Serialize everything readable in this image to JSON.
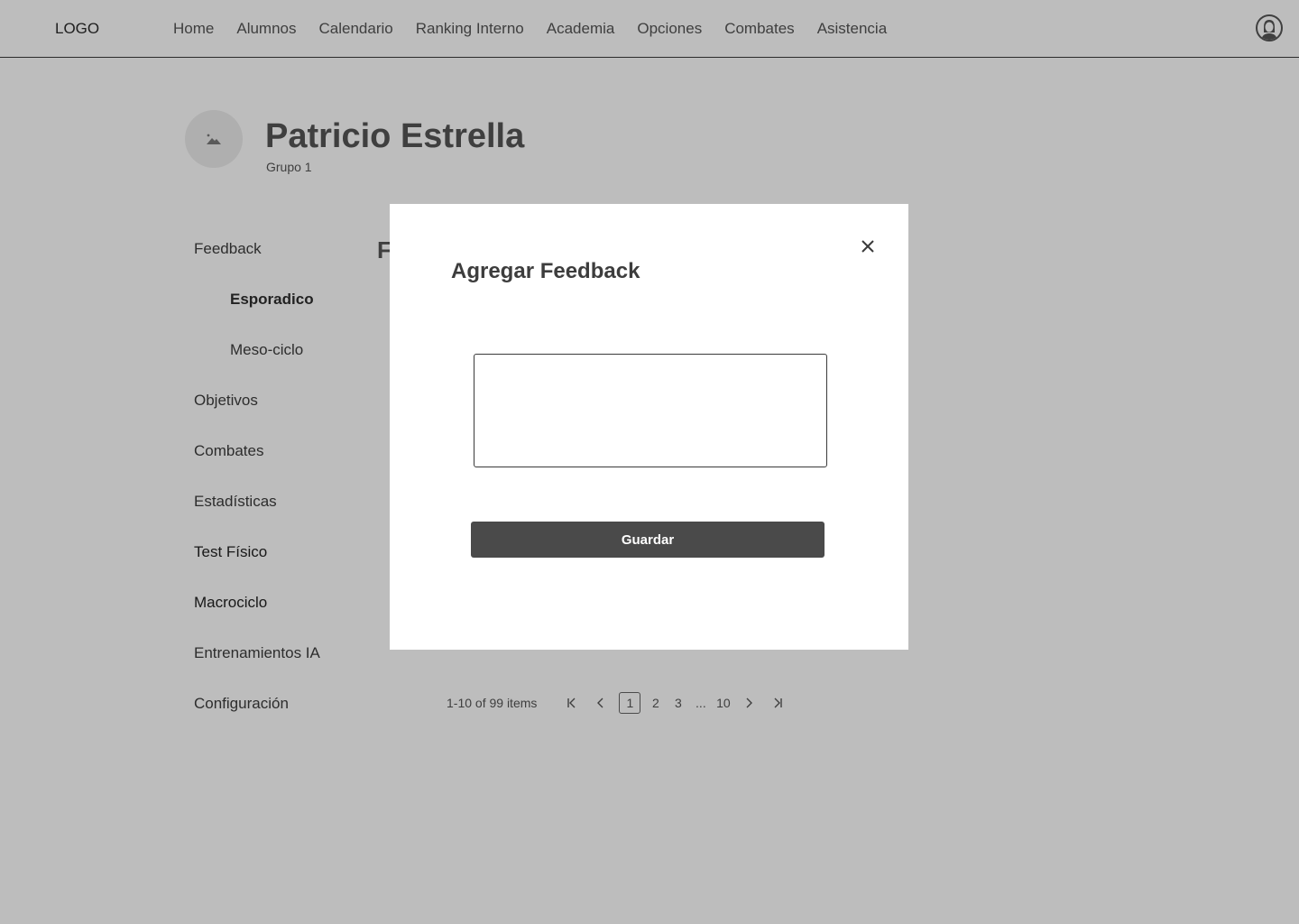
{
  "header": {
    "logo": "LOGO",
    "nav": [
      "Home",
      "Alumnos",
      "Calendario",
      "Ranking Interno",
      "Academia",
      "Opciones",
      "Combates",
      "Asistencia"
    ]
  },
  "profile": {
    "name": "Patricio Estrella",
    "group": "Grupo 1"
  },
  "sidebar": {
    "items": [
      {
        "label": "Feedback"
      },
      {
        "label": "Esporadico"
      },
      {
        "label": "Meso-ciclo"
      },
      {
        "label": "Objetivos"
      },
      {
        "label": "Combates"
      },
      {
        "label": "Estadísticas"
      },
      {
        "label": "Test Físico"
      },
      {
        "label": "Macrociclo"
      },
      {
        "label": "Entrenamientos IA"
      },
      {
        "label": "Configuración"
      }
    ]
  },
  "main": {
    "section_title_visible": "F"
  },
  "pagination": {
    "summary": "1-10 of 99 items",
    "pages": [
      "1",
      "2",
      "3",
      "...",
      "10"
    ],
    "current": "1"
  },
  "modal": {
    "title": "Agregar Feedback",
    "textarea_value": "",
    "save_label": "Guardar"
  },
  "colors": {
    "overlay": "#bdbdbd",
    "button": "#4a4a4a",
    "modal_bg": "#ffffff"
  }
}
